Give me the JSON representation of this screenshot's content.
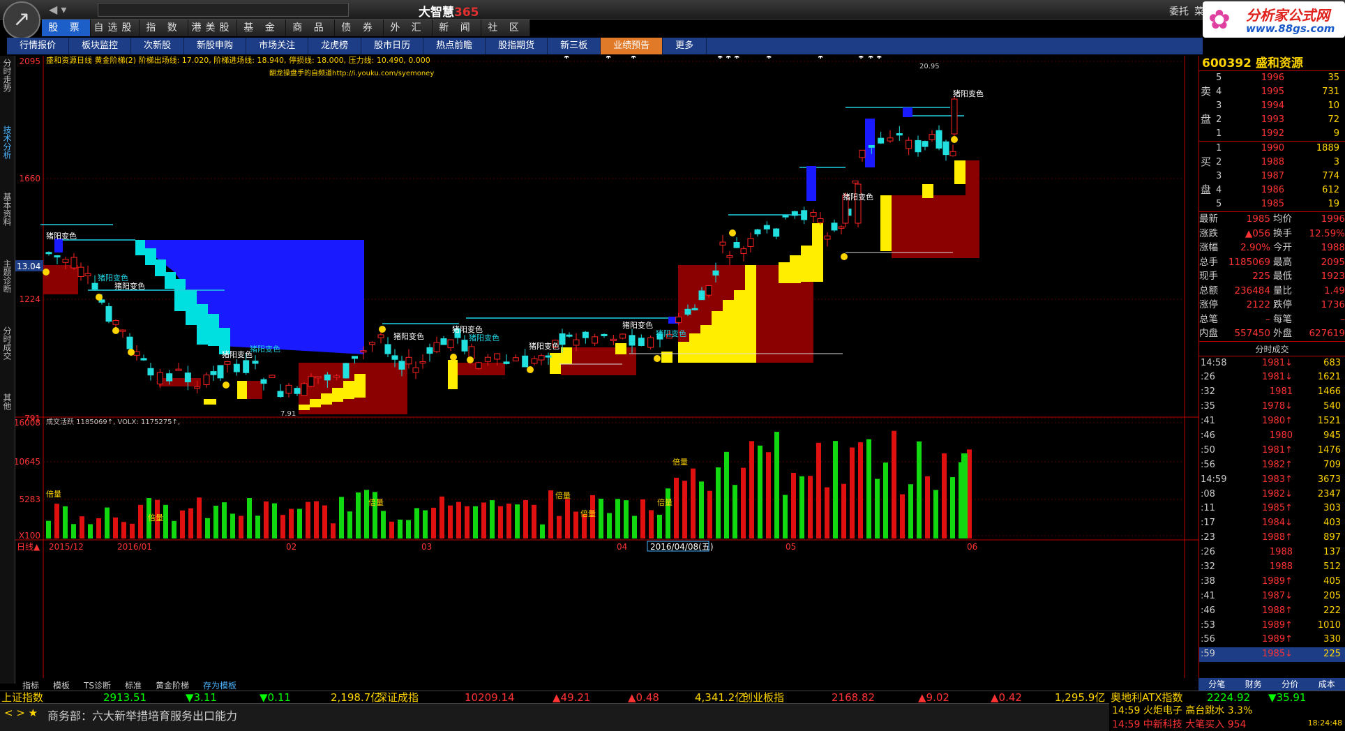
{
  "app": {
    "title": "大智慧",
    "title_suffix": "365",
    "menu1": "委托",
    "menu2": "菜"
  },
  "watermark": {
    "line1": "分析家公式网",
    "line2": "www.88gs.com"
  },
  "top_tabs": [
    "股 票",
    "自选股",
    "指 数",
    "港美股",
    "基 金",
    "商 品",
    "债 券",
    "外 汇",
    "新 闻",
    "社 区"
  ],
  "sub_tabs": [
    "行情报价",
    "板块监控",
    "次新股",
    "新股申购",
    "市场关注",
    "龙虎榜",
    "股市日历",
    "热点前瞻",
    "股指期货",
    "新三板",
    "业绩预告",
    "更多"
  ],
  "sidebar": [
    "分时走势",
    "技术分析",
    "基本资料",
    "主题诊断",
    "分时成交",
    "其他"
  ],
  "chart": {
    "header_line": "盛和资源日线  黄金阶梯(2)  阶梯出场线: 17.020, 阶梯进场线: 18.940, 停损线: 18.000, 压力线: 10.490, 0.000",
    "promo": "翻龙操盘手的自频道http://i.youku.com/syemoney",
    "price_axis": [
      "2095",
      "1660",
      "1224",
      "791"
    ],
    "current_price_label": "13.04",
    "peak_label": "20.95",
    "low_label": "7.91",
    "annotations": [
      "猪阳变色",
      "猪阳变色",
      "猪阳变色",
      "猪阳变色",
      "猪阳变色",
      "猪阳变色",
      "猪阳变色",
      "猪阳变色",
      "猪阳变色",
      "猪阳变色",
      "猪阳变色",
      "猪阳变色"
    ],
    "volume_header": "成交活跃  1185069↑, VOLX: 1175275↑,",
    "volume_axis": [
      "16008",
      "10645",
      "5283",
      "X100"
    ],
    "volume_labels": [
      "倍量",
      "倍量",
      "倍量",
      "倍量",
      "倍量",
      "倍量",
      "倍量"
    ],
    "date_axis": [
      "日线▲",
      "2015/12",
      "2016/01",
      "02",
      "03",
      "04",
      "2016/04/08(五)",
      "05",
      "06"
    ]
  },
  "stock": {
    "code": "600392",
    "name": "盛和资源"
  },
  "orderbook": {
    "sell_label": [
      "卖",
      "盘"
    ],
    "buy_label": [
      "买",
      "盘"
    ],
    "sells": [
      [
        "5",
        "1996",
        "35"
      ],
      [
        "4",
        "1995",
        "731"
      ],
      [
        "3",
        "1994",
        "10"
      ],
      [
        "2",
        "1993",
        "72"
      ],
      [
        "1",
        "1992",
        "9"
      ]
    ],
    "buys": [
      [
        "1",
        "1990",
        "1889"
      ],
      [
        "2",
        "1988",
        "3"
      ],
      [
        "3",
        "1987",
        "774"
      ],
      [
        "4",
        "1986",
        "612"
      ],
      [
        "5",
        "1985",
        "19"
      ]
    ]
  },
  "stats": [
    [
      "最新",
      "1985",
      "均价",
      "1996"
    ],
    [
      "涨跌",
      "▲056",
      "换手",
      "12.59%"
    ],
    [
      "涨幅",
      "2.90%",
      "今开",
      "1988"
    ],
    [
      "总手",
      "1185069",
      "最高",
      "2095"
    ],
    [
      "现手",
      "225",
      "最低",
      "1923"
    ],
    [
      "总额",
      "236484",
      "量比",
      "1.49"
    ],
    [
      "涨停",
      "2122",
      "跌停",
      "1736"
    ],
    [
      "总笔",
      "–",
      "每笔",
      "–"
    ],
    [
      "内盘",
      "557450",
      "外盘",
      "627619"
    ]
  ],
  "ticks_header": "分时成交",
  "ticks": [
    [
      "14:58",
      "1981↓",
      "683"
    ],
    [
      ":26",
      "1981↓",
      "1621"
    ],
    [
      ":32",
      "1981",
      "1466"
    ],
    [
      ":35",
      "1978↓",
      "540"
    ],
    [
      ":41",
      "1980↑",
      "1521"
    ],
    [
      ":46",
      "1980",
      "945"
    ],
    [
      ":50",
      "1981↑",
      "1476"
    ],
    [
      ":56",
      "1982↑",
      "709"
    ],
    [
      "14:59",
      "1983↑",
      "3673"
    ],
    [
      ":08",
      "1982↓",
      "2347"
    ],
    [
      ":11",
      "1985↑",
      "303"
    ],
    [
      ":17",
      "1984↓",
      "403"
    ],
    [
      ":23",
      "1988↑",
      "897"
    ],
    [
      ":26",
      "1988",
      "137"
    ],
    [
      ":32",
      "1988",
      "512"
    ],
    [
      ":38",
      "1989↑",
      "405"
    ],
    [
      ":41",
      "1987↓",
      "205"
    ],
    [
      ":46",
      "1988↑",
      "222"
    ],
    [
      ":53",
      "1989↑",
      "1010"
    ],
    [
      ":56",
      "1989↑",
      "330"
    ],
    [
      ":59",
      "1985↓",
      "225"
    ]
  ],
  "bottom_tabs": [
    "指标",
    "模板",
    "TS诊断",
    "标准",
    "黄金阶梯",
    "存为模板"
  ],
  "right_tabs": [
    "分笔",
    "财务",
    "分价",
    "成本"
  ],
  "index_bar": {
    "sh_name": "上证指数",
    "sh_val": "2913.51",
    "sh_chg": "▼3.11",
    "sh_pct": "▼0.11",
    "sh_amt": "2,198.7亿",
    "sz_name": "深证成指",
    "sz_val": "10209.14",
    "sz_chg": "▲49.21",
    "sz_pct": "▲0.48",
    "sz_amt": "4,341.2亿",
    "cy_name": "创业板指",
    "cy_val": "2168.82",
    "cy_chg": "▲9.02",
    "cy_pct": "▲0.42",
    "cy_amt": "1,295.9亿",
    "atx_name": "奥地利ATX指数",
    "atx_val": "2224.92",
    "atx_chg": "▼35.91"
  },
  "msgbar": {
    "nav": "< > ★",
    "news": "商务部：六大新举措培育服务出口能力"
  },
  "ticker": {
    "l1": "14:59 火炬电子 高台跳水 3.3%",
    "l2": "14:59 中新科技 大笔买入 954",
    "time": "18:24:48"
  },
  "colors": {
    "up": "#ff2222",
    "down": "#22e0e0",
    "vol_up": "#e01010",
    "vol_down": "#12d812",
    "stair": "#ffee00",
    "fill": "#8b0000",
    "block": "#1a1aff"
  }
}
